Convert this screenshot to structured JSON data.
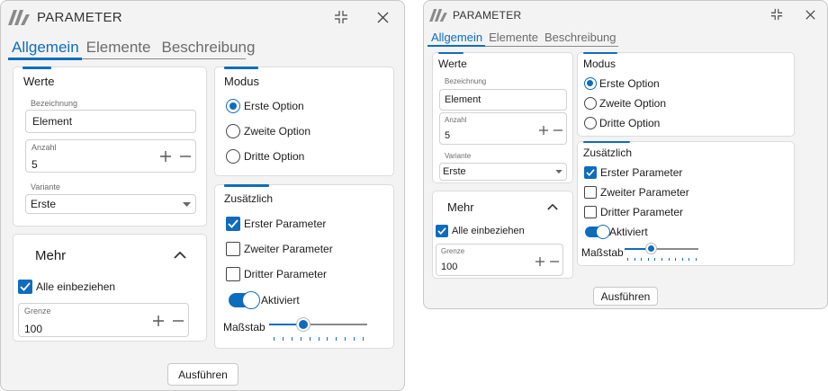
{
  "window": {
    "title": "PARAMETER",
    "tabs": [
      "Allgemein",
      "Elemente",
      "Beschreibung"
    ],
    "active_tab": "Allgemein"
  },
  "werte": {
    "title": "Werte",
    "bezeichnung_label": "Bezeichnung",
    "bezeichnung_value": "Element",
    "anzahl_label": "Anzahl",
    "anzahl_value": "5",
    "variante_label": "Variante",
    "variante_value": "Erste"
  },
  "modus": {
    "title": "Modus",
    "options": [
      "Erste Option",
      "Zweite Option",
      "Dritte Option"
    ],
    "selected": "Erste Option"
  },
  "zusaetzlich": {
    "title": "Zusätzlich",
    "params": [
      {
        "label": "Erster Parameter",
        "checked": true
      },
      {
        "label": "Zweiter Parameter",
        "checked": false
      },
      {
        "label": "Dritter Parameter",
        "checked": false
      }
    ],
    "toggle_label": "Aktiviert",
    "toggle_on": true,
    "scale_label": "Maßstab",
    "scale_level": 0.35
  },
  "mehr": {
    "title": "Mehr",
    "include_all_label": "Alle einbeziehen",
    "include_all_checked": true,
    "grenze_label": "Grenze",
    "grenze_value": "100"
  },
  "actions": {
    "run_label": "Ausführen"
  },
  "icons": {
    "logo": "app-logo-icon",
    "restore": "restore-icon",
    "close": "close-icon",
    "plus": "plus-icon",
    "minus": "minus-icon",
    "dropdown": "chevron-down-icon",
    "collapse": "chevron-up-icon"
  },
  "colors": {
    "accent": "#0f6cbd"
  }
}
